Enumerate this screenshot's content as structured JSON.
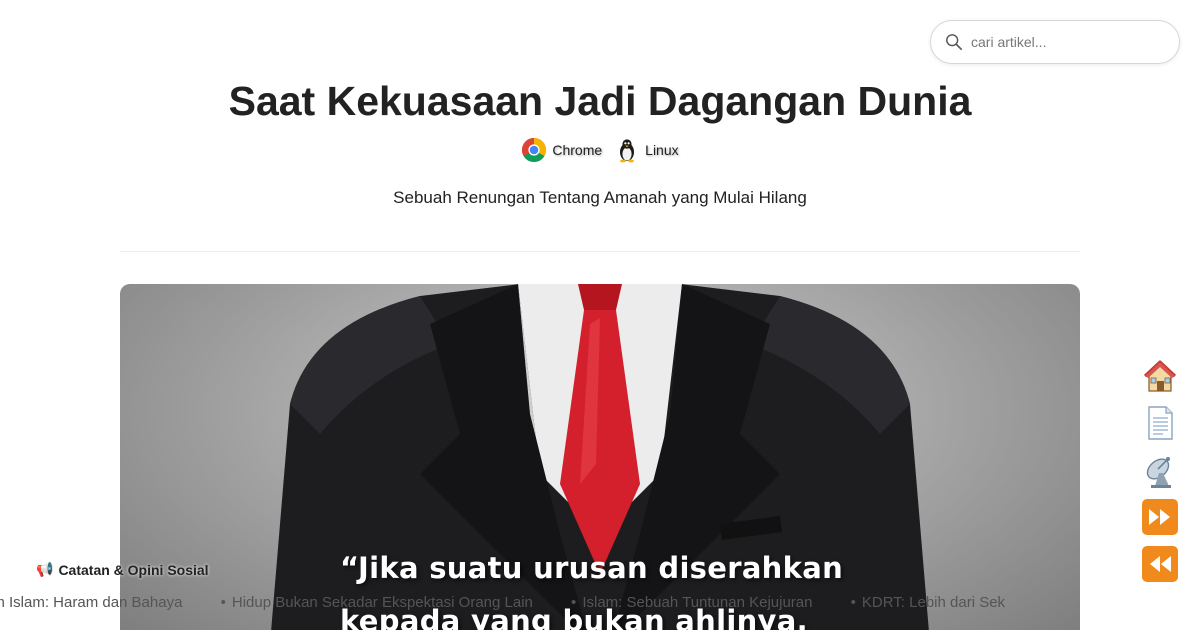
{
  "search": {
    "placeholder": "cari artikel..."
  },
  "article": {
    "title": "Saat Kekuasaan Jadi Dagangan Dunia",
    "meta": [
      {
        "label": "Chrome",
        "icon": "chrome-icon"
      },
      {
        "label": "Linux",
        "icon": "linux-tux-icon"
      }
    ],
    "subtitle": "Sebuah Renungan Tentang Amanah yang Mulai Hilang",
    "hero_quote_line1": "“Jika suatu urusan diserahkan",
    "hero_quote_line2": "kepada yang bukan ahlinya,"
  },
  "ticker": {
    "label": "Catatan & Opini Sosial",
    "label_icon": "megaphone-icon",
    "items": [
      "am Islam: Haram dan Bahaya",
      "Hidup Bukan Sekadar Ekspektasi Orang Lain",
      "Islam: Sebuah Tuntunan Kejujuran",
      "KDRT: Lebih dari Sek"
    ]
  },
  "side_nav": [
    {
      "name": "home-icon",
      "label": "Home"
    },
    {
      "name": "document-icon",
      "label": "Pages"
    },
    {
      "name": "satellite-antenna-icon",
      "label": "Feed"
    },
    {
      "name": "fast-forward-icon",
      "label": "Next"
    },
    {
      "name": "rewind-icon",
      "label": "Previous"
    }
  ],
  "colors": {
    "title": "#222222",
    "tie": "#d4202c",
    "suit": "#1c1c1e",
    "quote_text": "#ffffff",
    "nav_accent": "#f08a1c"
  }
}
